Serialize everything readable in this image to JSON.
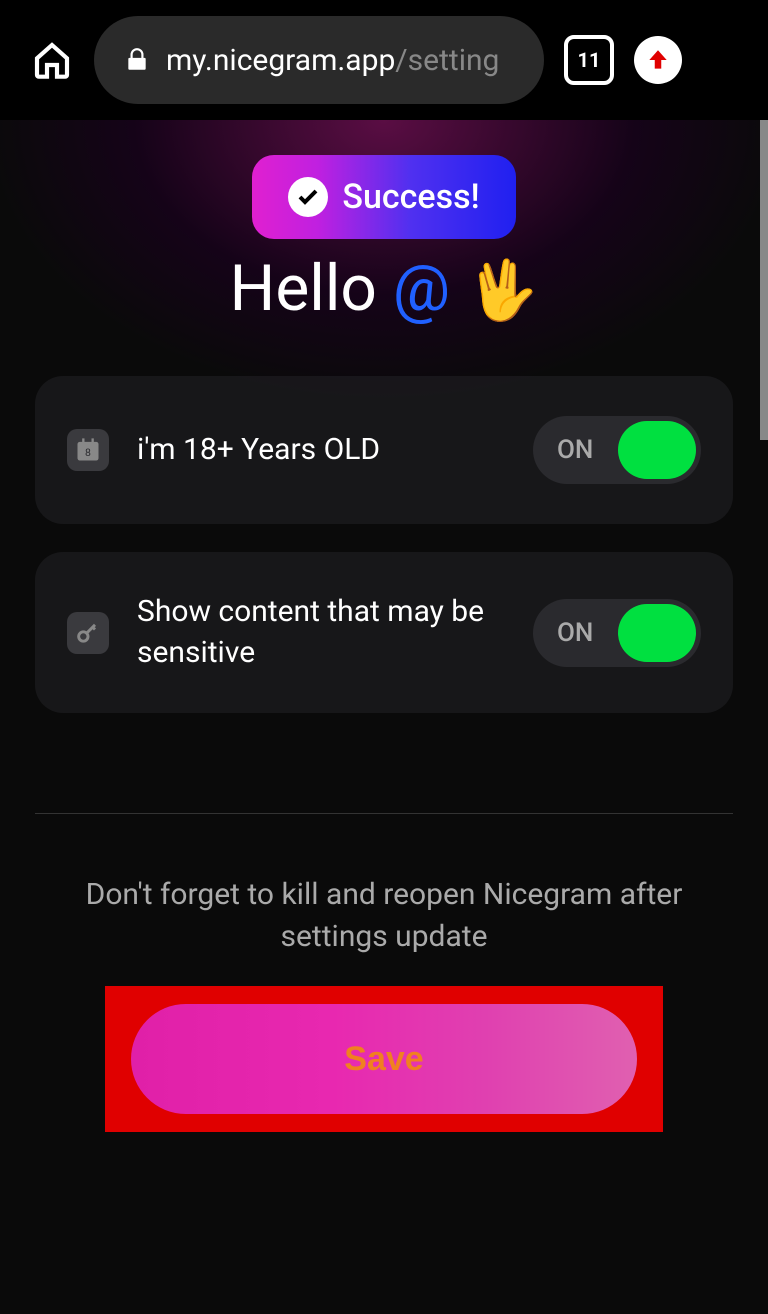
{
  "browser": {
    "url_host": "my.nicegram.app",
    "url_path": "/setting",
    "tab_count": "11"
  },
  "toast": {
    "label": "Success!"
  },
  "greeting": {
    "hello": "Hello ",
    "at": "@",
    "hand": "🖖"
  },
  "settings": [
    {
      "label": "i'm 18+ Years OLD",
      "toggle_text": "ON",
      "icon": "calendar-icon"
    },
    {
      "label": "Show content that may be sensitive",
      "toggle_text": "ON",
      "icon": "key-icon"
    }
  ],
  "reminder": "Don't forget to kill and reopen Nicegram after settings update",
  "save_label": "Save"
}
